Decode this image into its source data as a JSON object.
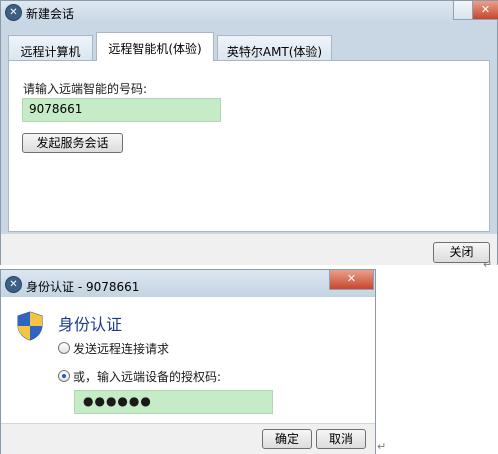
{
  "window1": {
    "title": "新建会话",
    "tabs": [
      {
        "label": "远程计算机",
        "active": false
      },
      {
        "label": "远程智能机(体验)",
        "active": true
      },
      {
        "label": "英特尔AMT(体验)",
        "active": false
      }
    ],
    "prompt": "请输入远端智能的号码:",
    "phone_value": "9078661",
    "start_button": "发起服务会话",
    "close_button": "关闭"
  },
  "window2": {
    "title": "身份认证 - 9078661",
    "heading": "身份认证",
    "options": [
      {
        "label": "发送远程连接请求",
        "selected": false
      },
      {
        "label": "或，输入远端设备的授权码:",
        "selected": true
      }
    ],
    "code_value": "●●●●●●",
    "ok_button": "确定",
    "cancel_button": "取消"
  },
  "icons": {
    "app": "app-logo-icon",
    "shield": "uac-shield-icon",
    "close": "close-icon"
  },
  "colors": {
    "input_highlight": "#c6ebc7",
    "heading_blue": "#1d3b8f"
  }
}
